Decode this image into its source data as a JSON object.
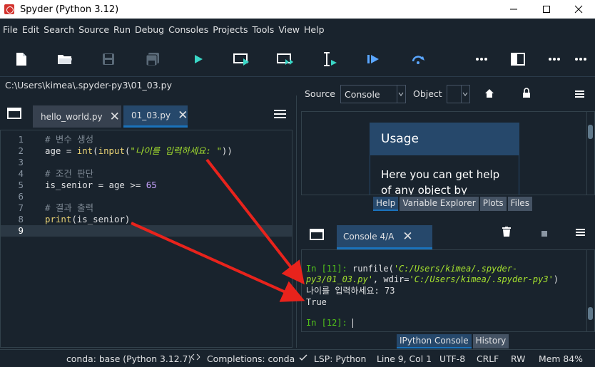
{
  "window": {
    "title": "Spyder (Python 3.12)"
  },
  "menu": [
    "File",
    "Edit",
    "Search",
    "Source",
    "Run",
    "Debug",
    "Consoles",
    "Projects",
    "Tools",
    "View",
    "Help"
  ],
  "toolbar": {
    "icons": [
      "new-file-icon",
      "open-folder-icon",
      "save-icon",
      "save-all-icon",
      "run-icon",
      "run-cell-icon",
      "run-cell-advance-icon",
      "run-selection-icon",
      "debug-icon",
      "debug-step-icon",
      "more-icon",
      "maximize-pane-icon",
      "more-icon"
    ]
  },
  "path": "C:\\Users\\kimea\\.spyder-py3\\01_03.py",
  "editor": {
    "tabs": [
      {
        "label": "hello_world.py",
        "active": false
      },
      {
        "label": "01_03.py",
        "active": true
      }
    ],
    "lines": [
      {
        "n": "1",
        "text": "# 변수 생성"
      },
      {
        "n": "2",
        "text": "age = int(input(\"나이를 입력하세요: \"))"
      },
      {
        "n": "3",
        "text": ""
      },
      {
        "n": "4",
        "text": "# 조건 판단"
      },
      {
        "n": "5",
        "text": "is_senior = age >= 65"
      },
      {
        "n": "6",
        "text": ""
      },
      {
        "n": "7",
        "text": "# 결과 출력"
      },
      {
        "n": "8",
        "text": "print(is_senior)"
      },
      {
        "n": "9",
        "text": ""
      }
    ],
    "code": {
      "l1": "# 변수 생성",
      "l2a": "age = ",
      "l2b": "int",
      "l2c": "(",
      "l2d": "input",
      "l2e": "(",
      "l2f": "\"나이를 입력하세요: \"",
      "l2g": "))",
      "l4": "# 조건 판단",
      "l5a": "is_senior = age >= ",
      "l5b": "65",
      "l7": "# 결과 출력",
      "l8a": "print",
      "l8b": "(is_senior)"
    }
  },
  "help": {
    "source_label": "Source",
    "source_value": "Console",
    "object_label": "Object",
    "usage_title": "Usage",
    "usage_text": "Here you can get help of any object by pressing",
    "tabs": [
      "Help",
      "Variable Explorer",
      "Plots",
      "Files"
    ]
  },
  "console": {
    "tab_label": "Console 4/A",
    "lines": {
      "in11_prompt": "In [11]: ",
      "in11_cmd": "runfile(",
      "in11_path1": "'C:/Users/kimea/.spyder-",
      "in11_path2": "py3/01_03.py'",
      "in11_mid": ", wdir=",
      "in11_wdir": "'C:/Users/kimea/.spyder-py3'",
      "in11_end": ")",
      "output1": "나이를 입력하세요: 73",
      "output2": "True",
      "in12_prompt": "In [12]: "
    },
    "tabs": [
      "IPython Console",
      "History"
    ]
  },
  "status": {
    "conda": "conda: base (Python 3.12.7)",
    "completions": "Completions: conda",
    "lsp": "LSP: Python",
    "position": "Line 9, Col 1",
    "encoding": "UTF-8",
    "eol": "CRLF",
    "mode": "RW",
    "mem": "Mem 84%"
  },
  "colors": {
    "background": "#19232d",
    "accent": "#1a72bb",
    "tab_active": "#26486b",
    "annotation_arrow": "#e8231c"
  }
}
